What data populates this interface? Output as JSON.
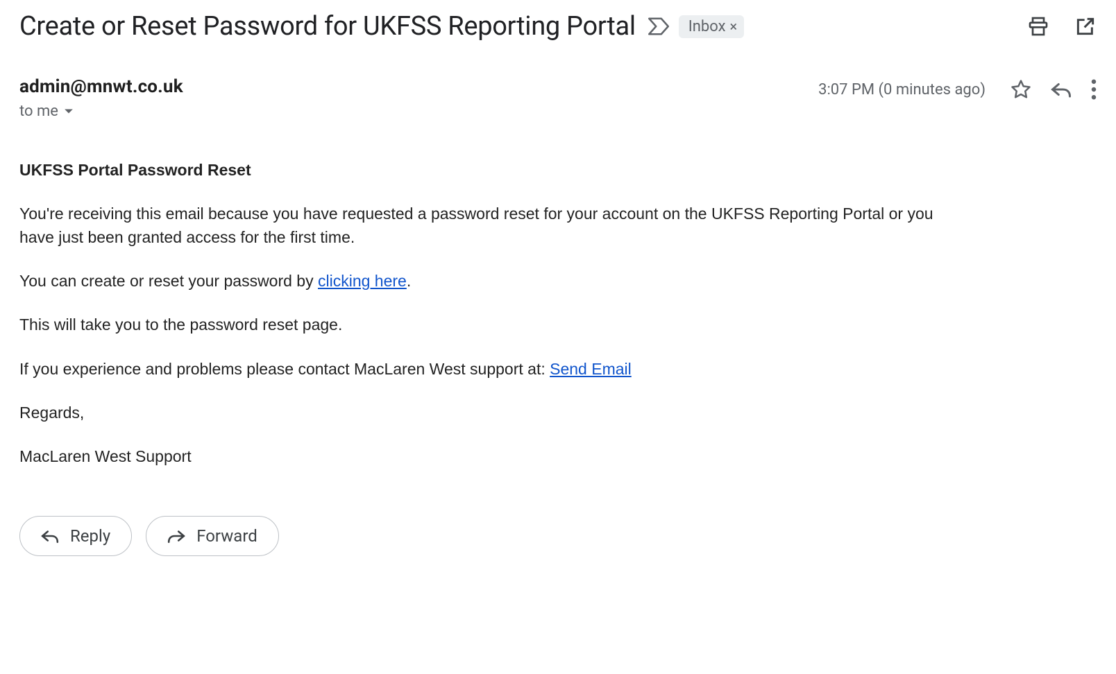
{
  "subject": "Create or Reset Password for UKFSS Reporting Portal",
  "label": {
    "name": "Inbox",
    "close": "×"
  },
  "sender": {
    "email": "admin@mnwt.co.uk"
  },
  "recipient": {
    "line": "to me"
  },
  "timestamp": "3:07 PM (0 minutes ago)",
  "body": {
    "heading": "UKFSS Portal Password Reset",
    "p1": "You're receiving this email because you have requested a password reset for your account on the UKFSS Reporting Portal or you have just been granted access for the first time.",
    "p2a": "You can create or reset your password by ",
    "p2_link": "clicking here",
    "p2b": ".",
    "p3": "This will take you to the password reset page.",
    "p4a": "If you experience and problems please contact MacLaren West support at: ",
    "p4_link": "Send Email",
    "p5": "Regards,",
    "p6": "MacLaren West Support"
  },
  "actions": {
    "reply": "Reply",
    "forward": "Forward"
  }
}
